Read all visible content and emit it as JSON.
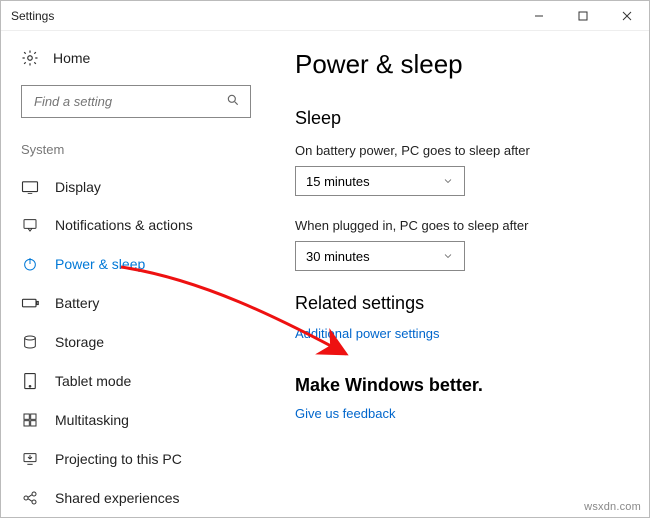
{
  "window": {
    "title": "Settings"
  },
  "home_label": "Home",
  "search": {
    "placeholder": "Find a setting"
  },
  "category": "System",
  "nav": {
    "display": "Display",
    "notifications": "Notifications & actions",
    "power": "Power & sleep",
    "battery": "Battery",
    "storage": "Storage",
    "tablet": "Tablet mode",
    "multitask": "Multitasking",
    "projecting": "Projecting to this PC",
    "shared": "Shared experiences"
  },
  "page": {
    "title": "Power & sleep",
    "sleep_heading": "Sleep",
    "battery_label": "On battery power, PC goes to sleep after",
    "battery_value": "15 minutes",
    "plugged_label": "When plugged in, PC goes to sleep after",
    "plugged_value": "30 minutes",
    "related_heading": "Related settings",
    "related_link": "Additional power settings",
    "feedback_heading": "Make Windows better.",
    "feedback_link": "Give us feedback"
  },
  "watermark": "wsxdn.com"
}
